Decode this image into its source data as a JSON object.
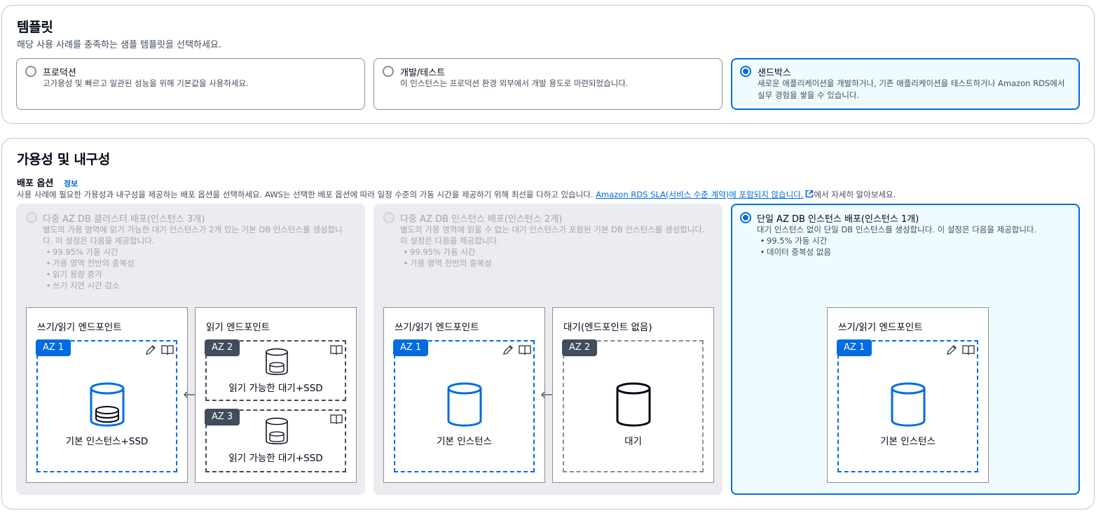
{
  "template": {
    "title": "템플릿",
    "subtitle": "해당 사용 사례를 충족하는 샘플 템플릿을 선택하세요.",
    "options": [
      {
        "label": "프로덕션",
        "desc": "고가용성 및 빠르고 일관된 성능을 위해 기본값을 사용하세요.",
        "selected": false
      },
      {
        "label": "개발/테스트",
        "desc": "이 인스턴스는 프로덕션 환경 외부에서 개발 용도로 마련되었습니다.",
        "selected": false
      },
      {
        "label": "샌드박스",
        "desc_line1": "새로운 애플리케이션을 개발하거나, 기존 애플리케이션을 테스트하거나 Amazon RDS에서",
        "desc_line2": "실무 경험을 쌓을 수 있습니다.",
        "selected": true
      }
    ]
  },
  "availability": {
    "title": "가용성 및 내구성",
    "deploy_label": "배포 옵션",
    "info": "정보",
    "desc_prefix": "사용 사례에 필요한 가용성과 내구성을 제공하는 배포 옵션을 선택하세요. AWS는 선택한 배포 옵션에 따라 일정 수준의 가동 시간을 제공하기 위해 최선을 다하고 있습니다. ",
    "desc_link": "Amazon RDS SLA(서비스 수준 계약)에 포함되지 않습니다.",
    "desc_suffix": "에서 자세히 알아보세요.",
    "options": [
      {
        "title": "다중 AZ DB 클러스터 배포(인스턴스 3개)",
        "desc_line1": "별도의 가용 영역에 읽기 가능한 대기 인스턴스가 2개 있는 기본 DB 인스턴스를 생성합니",
        "desc_line2": "다. 이 설정은 다음을 제공합니다.",
        "bullets": [
          "99.95% 가동 시간",
          "가용 영역 전반의 중복성",
          "읽기 용량 증가",
          "쓰기 지연 시간 감소"
        ],
        "enabled": false,
        "diagram": {
          "box1_title": "쓰기/읽기 엔드포인트",
          "box1_az": "AZ 1",
          "box1_label": "기본 인스턴스+SSD",
          "box2_title": "읽기 엔드포인트",
          "box2_az_a": "AZ 2",
          "box2_label_a": "읽기 가능한 대기+SSD",
          "box2_az_b": "AZ 3",
          "box2_label_b": "읽기 가능한 대기+SSD"
        }
      },
      {
        "title": "다중 AZ DB 인스턴스 배포(인스턴스 2개)",
        "desc_line1": "별도의 가용 영역에 읽을 수 없는 대기 인스턴스가 포함된 기본 DB 인스턴스를 생성합니다.",
        "desc_line2": "이 설정은 다음을 제공합니다.",
        "bullets": [
          "99.95% 가동 시간",
          "가용 영역 전반의 중복성"
        ],
        "enabled": false,
        "diagram": {
          "box1_title": "쓰기/읽기 엔드포인트",
          "box1_az": "AZ 1",
          "box1_label": "기본 인스턴스",
          "box2_title": "대기(엔드포인트 없음)",
          "box2_az": "AZ 2",
          "box2_label": "대기"
        }
      },
      {
        "title": "단일 AZ DB 인스턴스 배포(인스턴스 1개)",
        "desc_line1": "대기 인스턴스 없이 단일 DB 인스턴스를 생성합니다. 이 설정은 다음을 제공합니다.",
        "bullets": [
          "99.5% 가동 시간",
          "데이터 중복성 없음"
        ],
        "enabled": true,
        "selected": true,
        "diagram": {
          "box1_title": "쓰기/읽기 엔드포인트",
          "box1_az": "AZ 1",
          "box1_label": "기본 인스턴스"
        }
      }
    ]
  },
  "colors": {
    "accent": "#006ce0",
    "selected_bg": "#f0fbff",
    "disabled_bg": "#ebebf0"
  }
}
